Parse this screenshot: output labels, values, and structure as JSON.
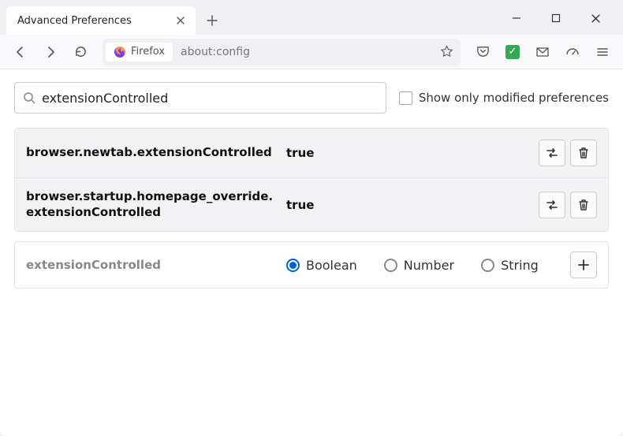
{
  "tab": {
    "title": "Advanced Preferences"
  },
  "urlbar": {
    "identity_label": "Firefox",
    "url": "about:config"
  },
  "search": {
    "value": "extensionControlled"
  },
  "show_modified_label": "Show only modified preferences",
  "prefs": [
    {
      "name": "browser.newtab.extensionControlled",
      "value": "true"
    },
    {
      "name": "browser.startup.homepage_override.extensionControlled",
      "value": "true"
    }
  ],
  "new_pref": {
    "name": "extensionControlled",
    "type_options": {
      "boolean": "Boolean",
      "number": "Number",
      "string": "String"
    },
    "selected": "boolean"
  }
}
